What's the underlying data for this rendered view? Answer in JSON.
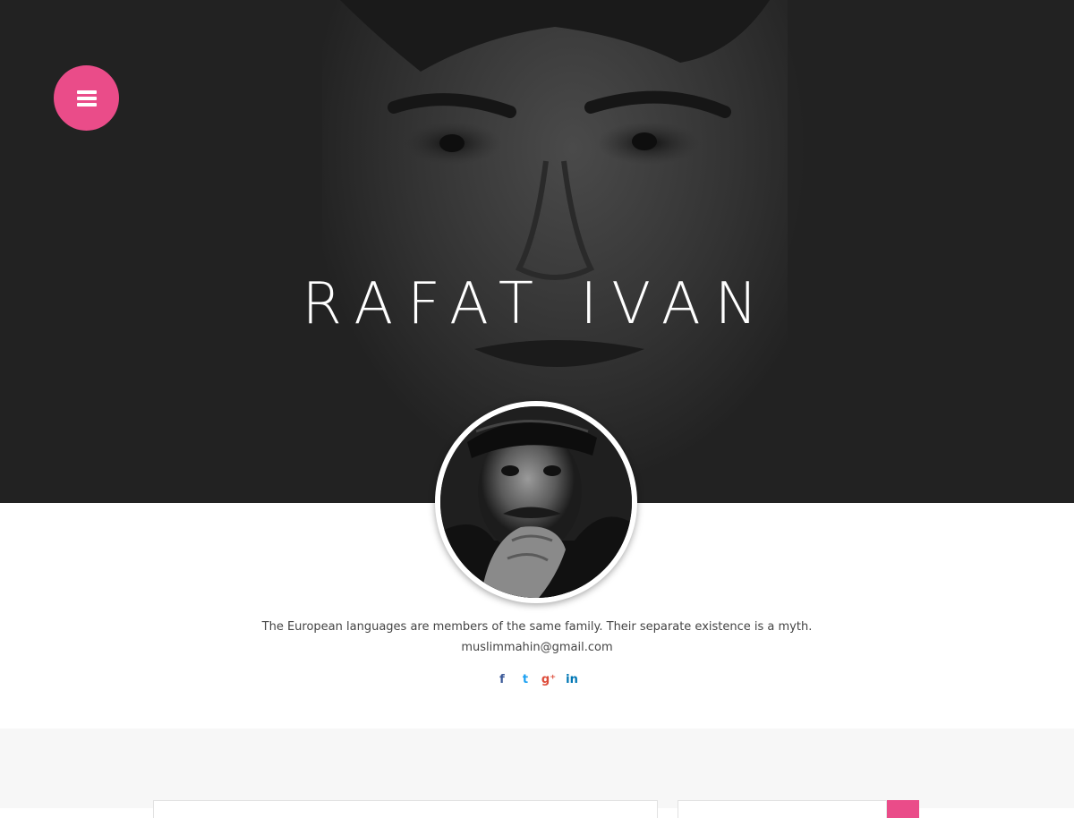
{
  "hero": {
    "title": "RAFAT IVAN"
  },
  "menu": {
    "icon": "hamburger-icon",
    "color": "#ea4c89"
  },
  "profile": {
    "bio": "The European languages are members of the same family. Their separate existence is a myth.",
    "email": "muslimmahin@gmail.com"
  },
  "social": [
    {
      "icon": "facebook-icon",
      "glyph": "f",
      "color": "#3b5998"
    },
    {
      "icon": "twitter-icon",
      "glyph": "t",
      "color": "#1da1f2"
    },
    {
      "icon": "google-plus-icon",
      "glyph": "g⁺",
      "color": "#dd4b39"
    },
    {
      "icon": "linkedin-icon",
      "glyph": "in",
      "color": "#0077b5"
    }
  ],
  "colors": {
    "accent": "#ea4c89",
    "hero_bg": "#222222",
    "lower_bg": "#f7f7f7"
  }
}
